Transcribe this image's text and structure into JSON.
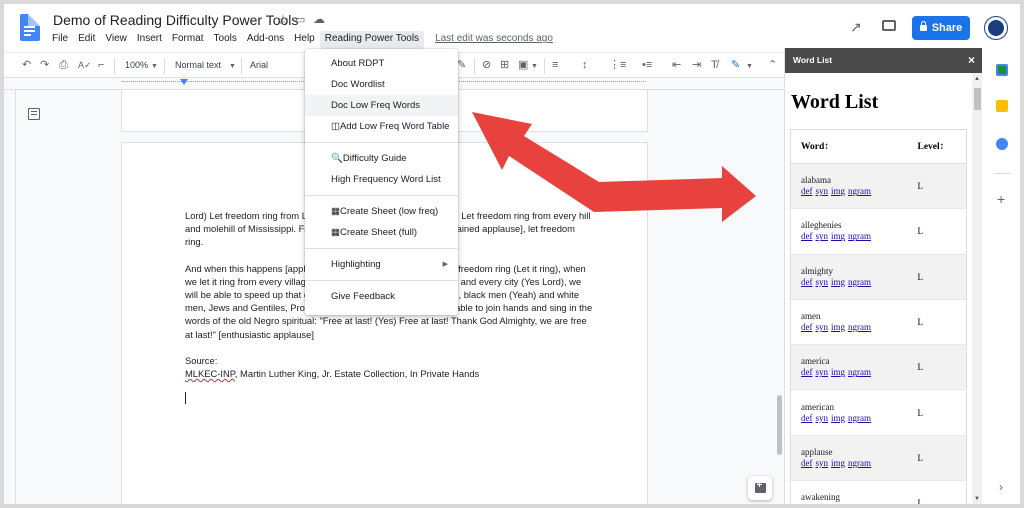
{
  "header": {
    "doc_title": "Demo of Reading Difficulty Power Tools",
    "star_icon": "star-icon",
    "move_icon": "folder-move-icon",
    "cloud_icon": "cloud-icon",
    "menus": [
      "File",
      "Edit",
      "View",
      "Insert",
      "Format",
      "Tools",
      "Add-ons",
      "Help",
      "Reading Power Tools"
    ],
    "last_edit": "Last edit was seconds ago",
    "share_label": "Share"
  },
  "toolbar": {
    "zoom": "100%",
    "style": "Normal text",
    "font": "Arial"
  },
  "document": {
    "paragraphs": [
      "Lord) Let freedom ring from Lookout Mountain of Tennessee (Yes) Let freedom ring from every hill and molehill of Mississippi. From every mountainside (Yeah) [sustained applause], let freedom ring.",
      "And when this happens [applause continues], and when we allow freedom ring (Let it ring), when we let it ring from every village and every hamlet, from every state and every city (Yes Lord), we will be able to speed up that day when all of God's children (Yeah), black men (Yeah) and white men, Jews and Gentiles, Protestants and Catholics (Yes), will be able to join hands and sing in the words of the old Negro spiritual: \"Free at last! (Yes) Free at last! Thank God Almighty, we are free at last!\" [enthusiastic applause]"
    ],
    "source_label": "Source:",
    "source_link": "MLKEC-INP",
    "source_rest": ", Martin Luther King, Jr. Estate Collection, In Private Hands"
  },
  "dropdown": {
    "items": [
      {
        "label": "About RDPT"
      },
      {
        "label": "Doc Wordlist"
      },
      {
        "label": "Doc Low Freq Words"
      },
      {
        "label": "◫Add Low Freq Word Table"
      },
      {
        "label": "🔍Difficulty Guide"
      },
      {
        "label": "High Frequency Word List"
      },
      {
        "label": "▦Create Sheet (low freq)"
      },
      {
        "label": "▦Create Sheet (full)"
      },
      {
        "label": "Highlighting"
      },
      {
        "label": "Give Feedback"
      }
    ]
  },
  "panel": {
    "header": "Word List",
    "close": "×",
    "title": "Word List",
    "col_word": "Word↕",
    "col_level": "Level↕",
    "link_labels": [
      "def",
      "syn",
      "img",
      "ngram"
    ],
    "rows": [
      {
        "word": "alabama",
        "level": "L"
      },
      {
        "word": "alleghenies",
        "level": "L"
      },
      {
        "word": "almighty",
        "level": "L"
      },
      {
        "word": "amen",
        "level": "L"
      },
      {
        "word": "america",
        "level": "L"
      },
      {
        "word": "american",
        "level": "L"
      },
      {
        "word": "applause",
        "level": "L"
      },
      {
        "word": "awakening",
        "level": "L"
      }
    ]
  },
  "colors": {
    "accent": "#1a73e8",
    "arrow": "#e8423f",
    "panel_header": "#4a4a4a"
  }
}
